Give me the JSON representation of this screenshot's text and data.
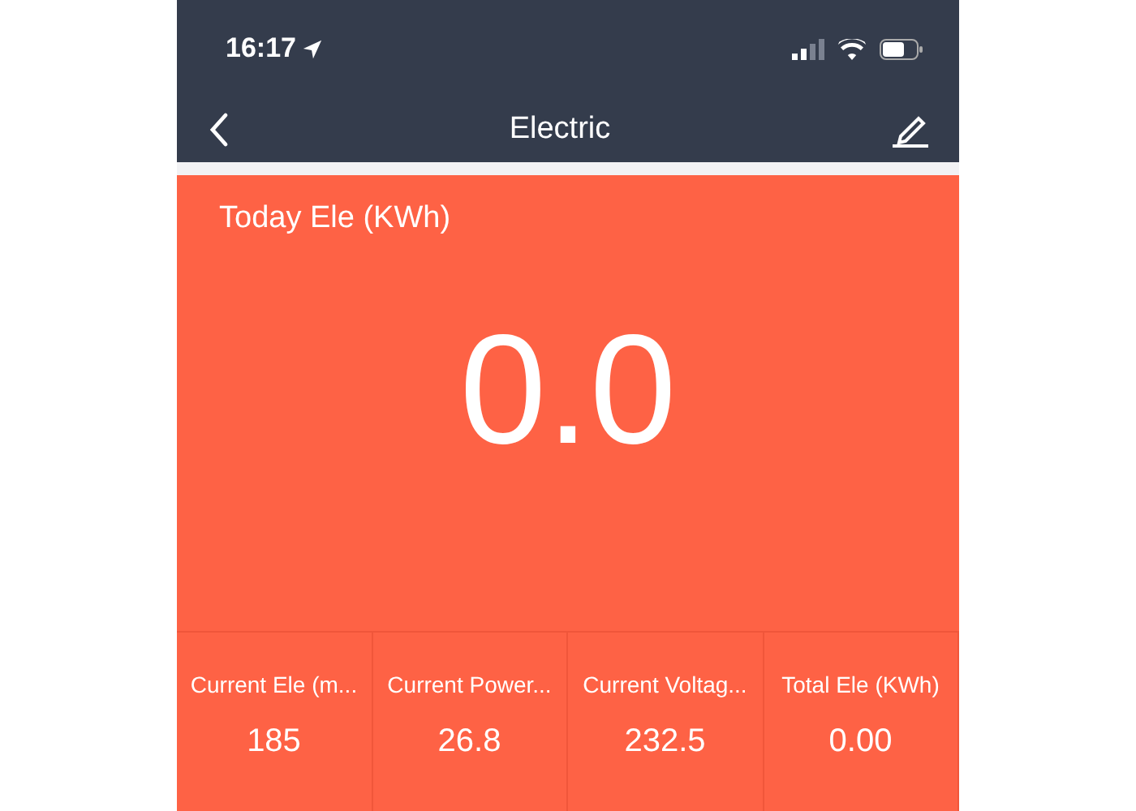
{
  "status_bar": {
    "time": "16:17"
  },
  "nav": {
    "title": "Electric"
  },
  "today": {
    "label": "Today Ele (KWh)",
    "value": "0.0"
  },
  "stats": [
    {
      "label": "Current Ele (m...",
      "value": "185"
    },
    {
      "label": "Current Power...",
      "value": "26.8"
    },
    {
      "label": "Current Voltag...",
      "value": "232.5"
    },
    {
      "label": "Total Ele (KWh)",
      "value": "0.00"
    }
  ]
}
